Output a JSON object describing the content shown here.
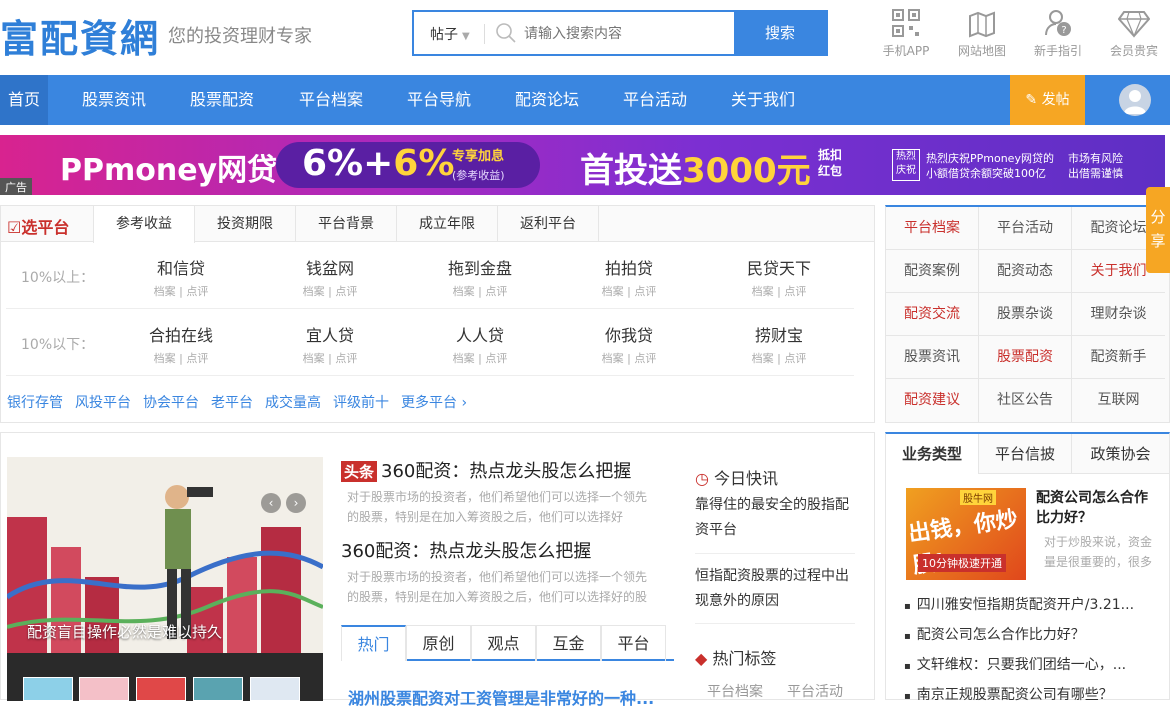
{
  "header": {
    "logo": "富配資網",
    "slogan": "您的投资理财专家",
    "search": {
      "type": "帖子",
      "placeholder": "请输入搜索内容",
      "button": "搜索"
    },
    "icons": [
      {
        "label": "手机APP",
        "icon": "qr-icon"
      },
      {
        "label": "网站地图",
        "icon": "map-icon"
      },
      {
        "label": "新手指引",
        "icon": "help-icon"
      },
      {
        "label": "会员贵宾",
        "icon": "diamond-icon"
      }
    ]
  },
  "nav": {
    "items": [
      "首页",
      "股票资讯",
      "股票配资",
      "平台档案",
      "平台导航",
      "配资论坛",
      "平台活动",
      "关于我们"
    ],
    "post": "发帖"
  },
  "banner": {
    "brand": "PPmoney网贷",
    "rate_a": "6%+",
    "rate_b": "6%",
    "rate_tag1": "专享加息",
    "rate_tag2": "(参考收益)",
    "main_a": "首投送",
    "main_b": "3000元",
    "main_tag": "抵扣红包",
    "box": "热烈庆祝",
    "right1a": "热烈庆祝PPmoney网贷的",
    "right1b": "小额借贷余额突破100亿",
    "right2a": "市场有风险",
    "right2b": "出借需谨慎",
    "ad": "广告"
  },
  "filter": {
    "title": "选平台",
    "tabs": [
      "参考收益",
      "投资期限",
      "平台背景",
      "成立年限",
      "返利平台"
    ],
    "sub": "档案 | 点评",
    "rows": [
      {
        "label": "10%以上：",
        "platforms": [
          "和信贷",
          "钱盆网",
          "拖到金盘",
          "拍拍贷",
          "民贷天下"
        ]
      },
      {
        "label": "10%以下：",
        "platforms": [
          "合拍在线",
          "宜人贷",
          "人人贷",
          "你我贷",
          "捞财宝"
        ]
      }
    ],
    "links": [
      "银行存管",
      "风投平台",
      "协会平台",
      "老平台",
      "成交量高",
      "评级前十",
      "更多平台 ›"
    ]
  },
  "grid": [
    "平台档案",
    "平台活动",
    "配资论坛",
    "配资案例",
    "配资动态",
    "关于我们",
    "配资交流",
    "股票杂谈",
    "理财杂谈",
    "股票资讯",
    "股票配资",
    "配资新手",
    "配资建议",
    "社区公告",
    "互联网"
  ],
  "grid_red": [
    "平台档案",
    "关于我们",
    "配资交流",
    "股票配资",
    "配资建议"
  ],
  "share": "分享",
  "slider": {
    "caption": "配资盲目操作必然是难以持久",
    "prev": "‹",
    "next": "›"
  },
  "articles": [
    {
      "badge": "头条",
      "title": "360配资：热点龙头股怎么把握",
      "desc1": "对于股票市场的投资者，他们希望他们可以选择一个领先",
      "desc2": "的股票，特别是在加入筹资股之后，他们可以选择好"
    },
    {
      "title": "360配资：热点龙头股怎么把握",
      "desc1": "对于股票市场的投资者，他们希望他们可以选择一个领先",
      "desc2": "的股票，特别是在加入筹资股之后，他们可以选择好的股"
    }
  ],
  "tabs2": [
    "热门",
    "原创",
    "观点",
    "互金",
    "平台"
  ],
  "tab_line": "湖州股票配资对工资管理是非常好的一种...",
  "news": {
    "title": "今日快讯",
    "items": [
      "靠得住的最安全的股指配资平台",
      "恒指配资股票的过程中出现意外的原因"
    ]
  },
  "tags": {
    "title": "热门标签",
    "items": [
      "平台档案",
      "平台活动"
    ]
  },
  "rbox": {
    "tabs": [
      "业务类型",
      "平台信披",
      "政策协会"
    ],
    "img": {
      "brand": "股牛网",
      "line1": "出钱，你炒股!",
      "line2": "10分钟极速开通"
    },
    "title": "配资公司怎么合作比力好？",
    "desc": "对于炒股来说，资金量是很重要的，很多",
    "list": [
      "四川雅安恒指期货配资开户/3.21...",
      "配资公司怎么合作比力好？",
      "文轩维权：只要我们团结一心，...",
      "南京正规股票配资公司有哪些？"
    ]
  }
}
